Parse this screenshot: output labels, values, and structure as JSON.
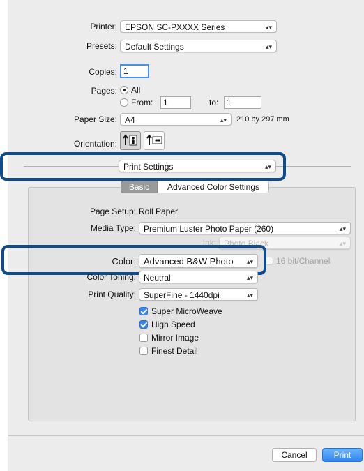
{
  "printer": {
    "label": "Printer:",
    "value": "EPSON SC-PXXXX Series"
  },
  "presets": {
    "label": "Presets:",
    "value": "Default Settings"
  },
  "copies": {
    "label": "Copies:",
    "value": "1"
  },
  "pages": {
    "label": "Pages:",
    "all_label": "All",
    "from_label": "From:",
    "from_value": "1",
    "to_label": "to:",
    "to_value": "1"
  },
  "paper_size": {
    "label": "Paper Size:",
    "value": "A4",
    "dimensions": "210 by 297 mm"
  },
  "orientation": {
    "label": "Orientation:",
    "portrait_icon": "portrait-orientation-icon",
    "landscape_icon": "landscape-orientation-icon"
  },
  "section_popup": {
    "value": "Print Settings"
  },
  "tabs": [
    {
      "label": "Basic",
      "selected": true
    },
    {
      "label": "Advanced Color Settings",
      "selected": false
    }
  ],
  "settings": {
    "page_setup_label": "Page Setup:",
    "page_setup_value": "Roll Paper",
    "media_type_label": "Media Type:",
    "media_type_value": "Premium Luster Photo Paper (260)",
    "ink_label": "Ink:",
    "ink_value": "Photo Black",
    "color_label": "Color:",
    "color_value": "Advanced B&W Photo",
    "bit_label": "16 bit/Channel",
    "color_toning_label": "Color Toning:",
    "color_toning_value": "Neutral",
    "print_quality_label": "Print Quality:",
    "print_quality_value": "SuperFine - 1440dpi",
    "checks": [
      {
        "label": "Super MicroWeave",
        "checked": true
      },
      {
        "label": "High Speed",
        "checked": true
      },
      {
        "label": "Mirror Image",
        "checked": false
      },
      {
        "label": "Finest Detail",
        "checked": false
      }
    ]
  },
  "buttons": {
    "cancel": "Cancel",
    "print": "Print"
  },
  "colors": {
    "accent": "#3b86e8",
    "highlight": "#0f4c8c",
    "panel": "#e3e3e3",
    "dialog": "#ececec"
  }
}
